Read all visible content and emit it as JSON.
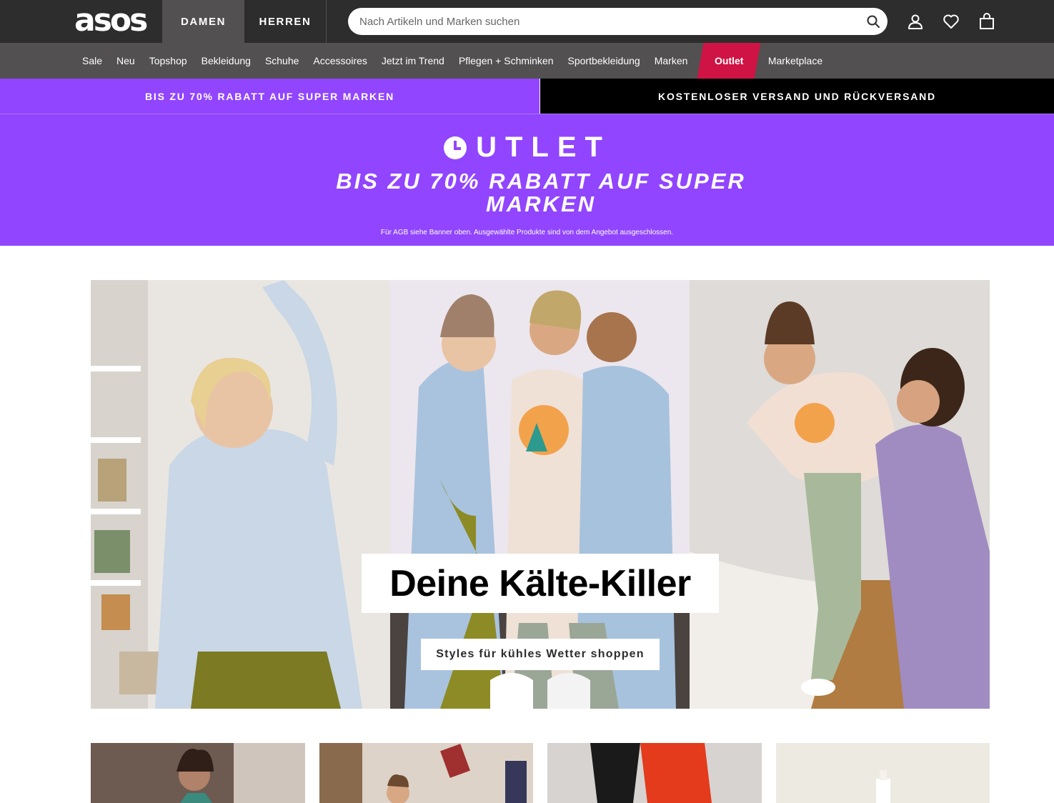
{
  "header": {
    "logo": "asos",
    "genders": [
      "DAMEN",
      "HERREN"
    ],
    "search": {
      "placeholder": "Nach Artikeln und Marken suchen"
    },
    "icons": [
      "search-icon",
      "account-icon",
      "heart-icon",
      "bag-icon"
    ]
  },
  "nav": {
    "items": [
      "Sale",
      "Neu",
      "Topshop",
      "Bekleidung",
      "Schuhe",
      "Accessoires",
      "Jetzt im Trend",
      "Pflegen + Schminken",
      "Sportbekleidung",
      "Marken",
      "Outlet",
      "Marketplace"
    ]
  },
  "promo": {
    "left": "BIS ZU 70% RABATT AUF SUPER MARKEN",
    "right": "KOSTENLOSER VERSAND UND RÜCKVERSAND"
  },
  "outlet_banner": {
    "title": "UTLET",
    "subtitle": "BIS ZU 70% RABATT AUF SUPER MARKEN",
    "note": "Für AGB siehe Banner oben. Ausgewählte Produkte sind von dem Angebot ausgeschlossen."
  },
  "hero": {
    "title": "Deine Kälte-Killer",
    "cta": "Styles für kühles Wetter shoppen"
  },
  "colors": {
    "header_bg": "#2d2d2d",
    "nav_bg": "#525050",
    "outlet_red": "#d01345",
    "promo_purple": "#9145ff"
  }
}
